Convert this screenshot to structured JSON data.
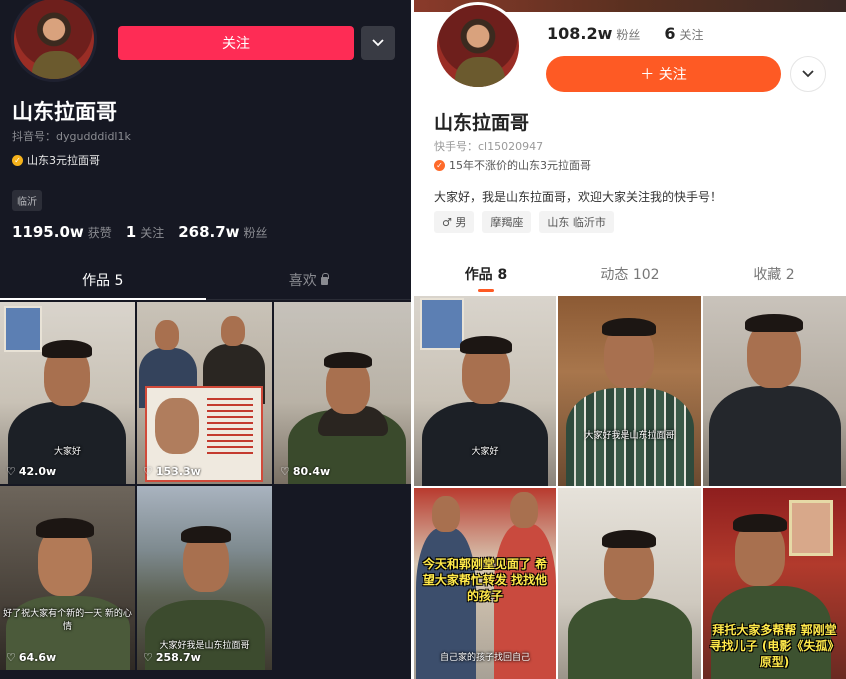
{
  "douyin": {
    "follow_label": "关注",
    "more_icon": "chevron-down-icon",
    "nickname": "山东拉面哥",
    "account_id": "抖音号：dygudddidl1k",
    "verify_text": "山东3元拉面哥",
    "location_tag": "临沂",
    "stats": [
      {
        "num": "1195.0w",
        "label": "获赞"
      },
      {
        "num": "1",
        "label": "关注"
      },
      {
        "num": "268.7w",
        "label": "粉丝"
      }
    ],
    "tabs": [
      {
        "label": "作品 5"
      },
      {
        "label": "喜欢"
      }
    ],
    "videos": [
      {
        "likes": "42.0w",
        "subtitle": "大家好"
      },
      {
        "likes": "153.3w",
        "subtitle": ""
      },
      {
        "likes": "80.4w",
        "subtitle": ""
      },
      {
        "likes": "64.6w",
        "subtitle": "好了祝大家有个新的一天 新的心情"
      },
      {
        "likes": "258.7w",
        "subtitle": "大家好我是山东拉面哥"
      }
    ]
  },
  "kuaishou": {
    "stats": [
      {
        "num": "108.2w",
        "label": "粉丝"
      },
      {
        "num": "6",
        "label": "关注"
      }
    ],
    "follow_label": "＋ 关注",
    "more_icon": "chevron-down-icon",
    "nickname": "山东拉面哥",
    "account_id": "快手号：cl15020947",
    "verify_text": "15年不涨价的山东3元拉面哥",
    "bio": "大家好，我是山东拉面哥，欢迎大家关注我的快手号！",
    "tags": [
      "♂ 男",
      "摩羯座",
      "山东 临沂市"
    ],
    "tabs": [
      {
        "label": "作品 8"
      },
      {
        "label": "动态 102"
      },
      {
        "label": "收藏 2"
      }
    ],
    "videos": [
      {
        "caption": "大家好"
      },
      {
        "caption": "大家好我是山东拉面哥"
      },
      {
        "caption": ""
      },
      {
        "caption": "今天和郭刚堂见面了 希望大家帮忙转发 找找他的孩子",
        "caption2": "自己家的孩子找回自己"
      },
      {
        "caption": ""
      },
      {
        "caption": "拜托大家多帮帮 郭刚堂寻找儿子 (电影《失孤》原型)"
      }
    ]
  },
  "colors": {
    "douyin_bg": "#161823",
    "douyin_accent": "#fe2c55",
    "kuaishou_accent": "#fe5a24"
  }
}
